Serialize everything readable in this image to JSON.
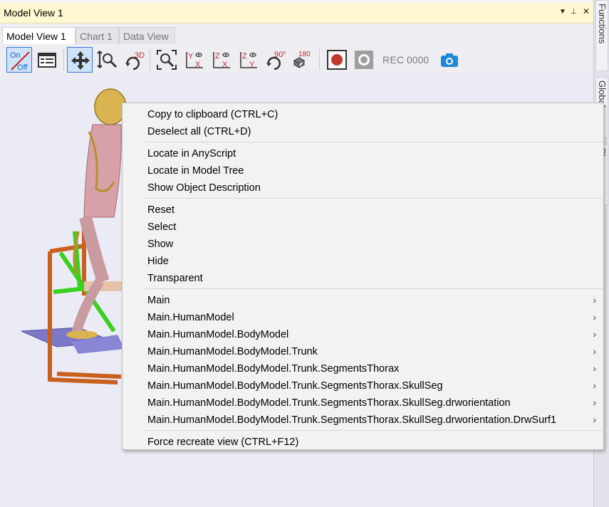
{
  "window": {
    "title": "Model View 1"
  },
  "side_tabs": [
    "Functions",
    "Globals",
    "Classes"
  ],
  "tabs": [
    {
      "label": "Model View 1",
      "active": true
    },
    {
      "label": "Chart 1",
      "active": false
    },
    {
      "label": "Data View",
      "active": false
    }
  ],
  "toolbar": {
    "onoff_on": "On",
    "onoff_off": "Off",
    "rot3d_label": "3D",
    "rot90_label": "90",
    "rot180_label": "180",
    "rec_label": "REC",
    "rec_counter": "0000",
    "icons": [
      "onoff-toggle-icon",
      "properties-panel-icon",
      "pan-move-icon",
      "zoom-icon",
      "rotate-3d-icon",
      "zoom-fit-icon",
      "view-yx-icon",
      "view-zx-icon",
      "view-zy-icon",
      "rotate-90-icon",
      "rotate-180-icon",
      "record-icon",
      "stop-icon",
      "camera-icon"
    ]
  },
  "context_menu": {
    "groups": [
      [
        "Copy to clipboard (CTRL+C)",
        "Deselect all (CTRL+D)"
      ],
      [
        "Locate in AnyScript",
        "Locate in Model Tree",
        "Show Object Description"
      ],
      [
        "Reset",
        "Select",
        "Show",
        "Hide",
        "Transparent"
      ],
      [
        "Main",
        "Main.HumanModel",
        "Main.HumanModel.BodyModel",
        "Main.HumanModel.BodyModel.Trunk",
        "Main.HumanModel.BodyModel.Trunk.SegmentsThorax",
        "Main.HumanModel.BodyModel.Trunk.SegmentsThorax.SkullSeg",
        "Main.HumanModel.BodyModel.Trunk.SegmentsThorax.SkullSeg.drworientation",
        "Main.HumanModel.BodyModel.Trunk.SegmentsThorax.SkullSeg.drworientation.DrwSurf1"
      ],
      [
        "Force recreate view (CTRL+F12)"
      ]
    ],
    "submenu_group": 3,
    "submenu_arrow": "›"
  },
  "colors": {
    "accent": "#3a7bd5",
    "record": "#c0392b",
    "camera": "#1e88d8",
    "title_bg": "#fff7d1"
  }
}
